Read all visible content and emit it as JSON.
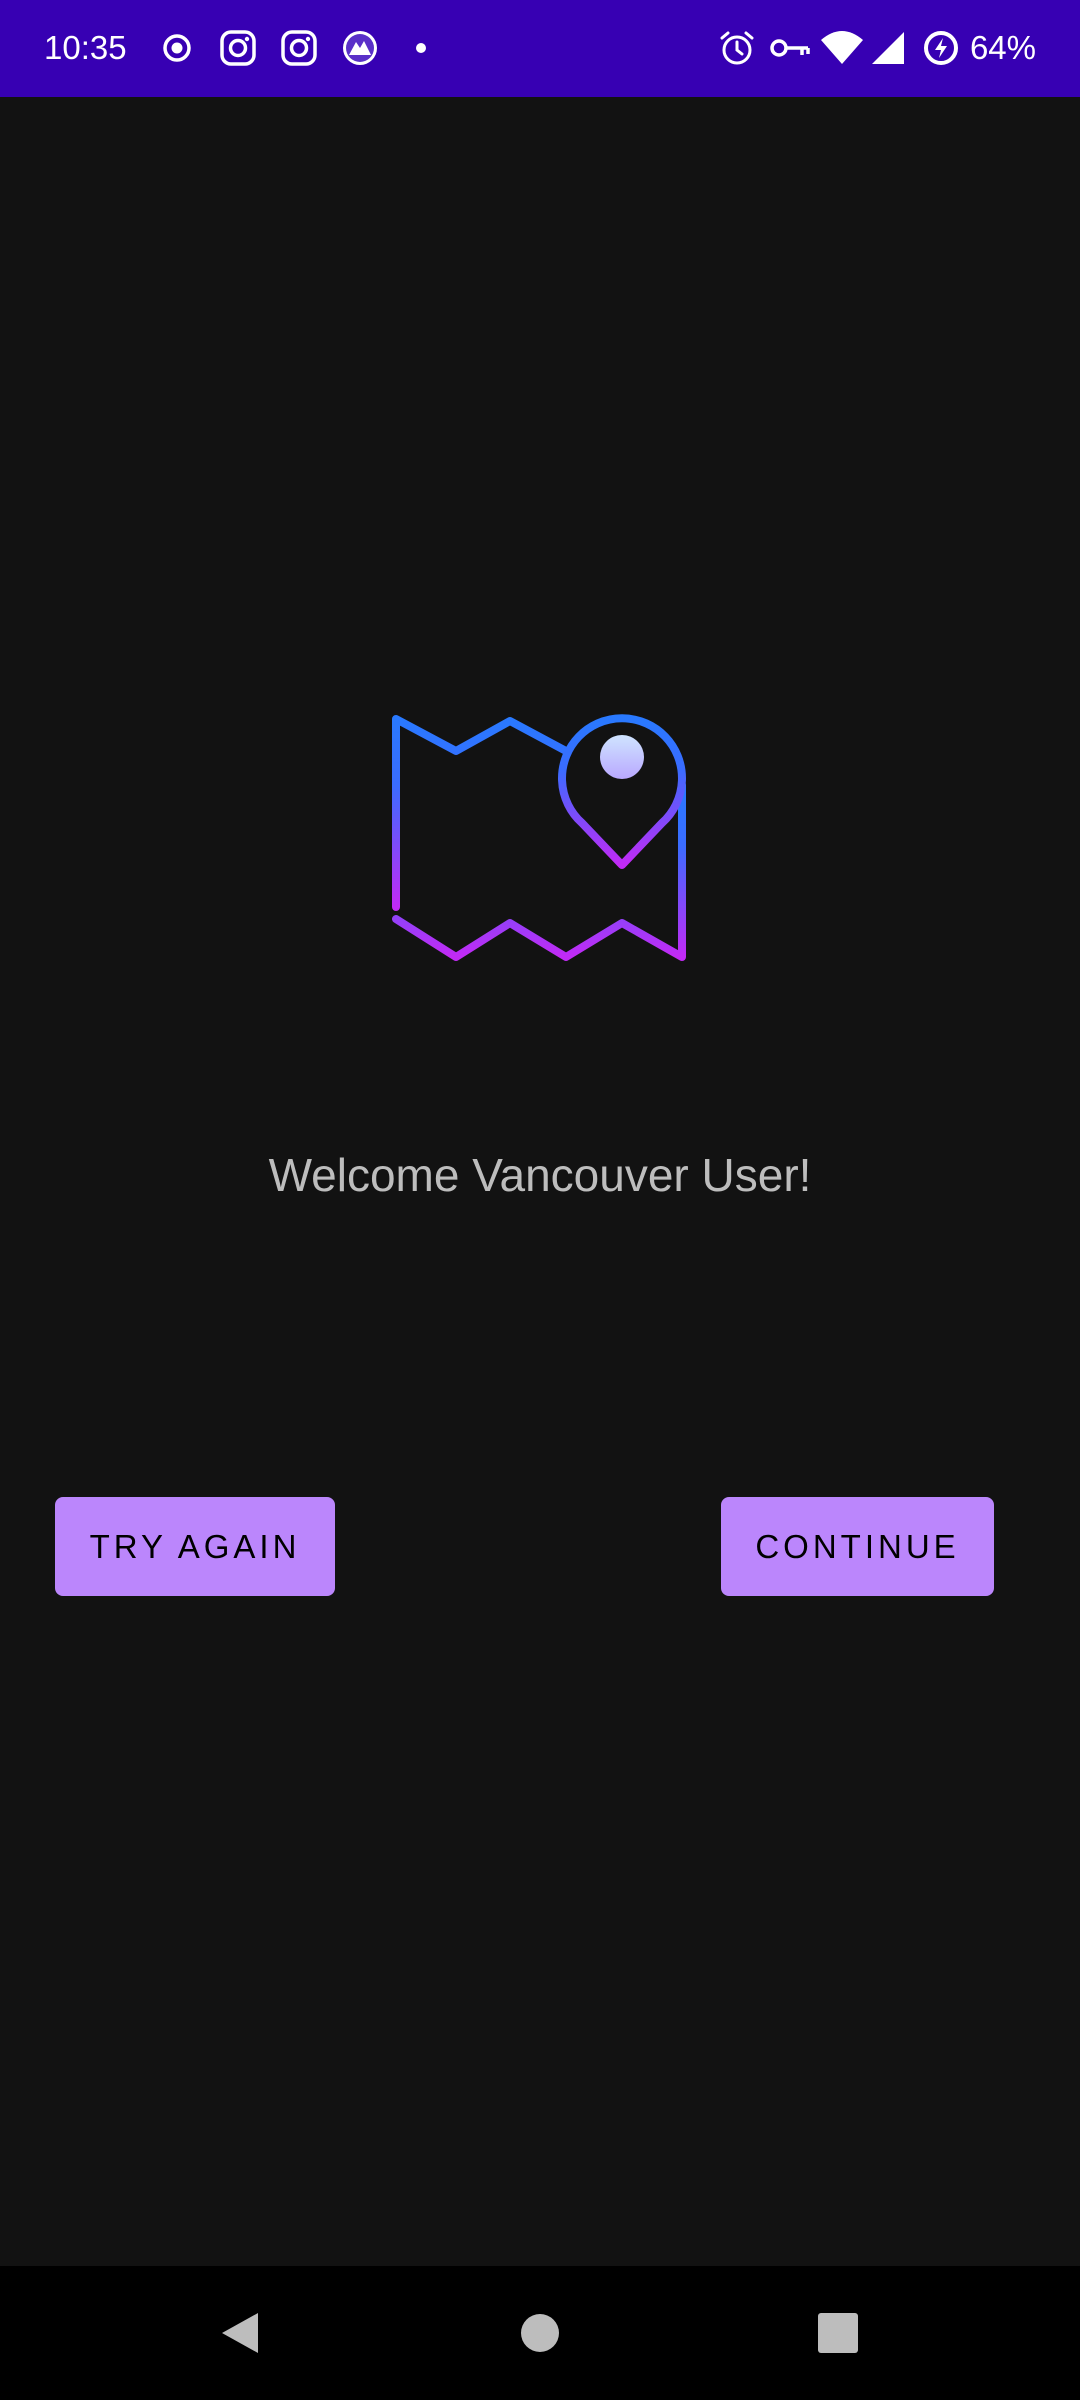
{
  "status_bar": {
    "time": "10:35",
    "battery": "64%",
    "background_color": "#3700b3",
    "left_icons": [
      "record-icon",
      "instagram-icon",
      "instagram-icon",
      "vpn-app-icon",
      "dot-icon"
    ],
    "right_icons": [
      "alarm-icon",
      "vpn-key-icon",
      "wifi-icon",
      "signal-icon",
      "battery-saver-icon"
    ]
  },
  "main": {
    "logo_icon": "map-pin-icon",
    "logo_gradient": [
      "#2979ff",
      "#c22af5"
    ],
    "welcome_text": "Welcome Vancouver User!",
    "welcome_color": "#bdbdbd",
    "background_color": "#121212"
  },
  "actions": {
    "try_again_label": "TRY AGAIN",
    "continue_label": "CONTINUE",
    "button_color": "#bb86fc"
  },
  "nav_bar": {
    "buttons": [
      "back-icon",
      "home-icon",
      "recents-icon"
    ]
  }
}
